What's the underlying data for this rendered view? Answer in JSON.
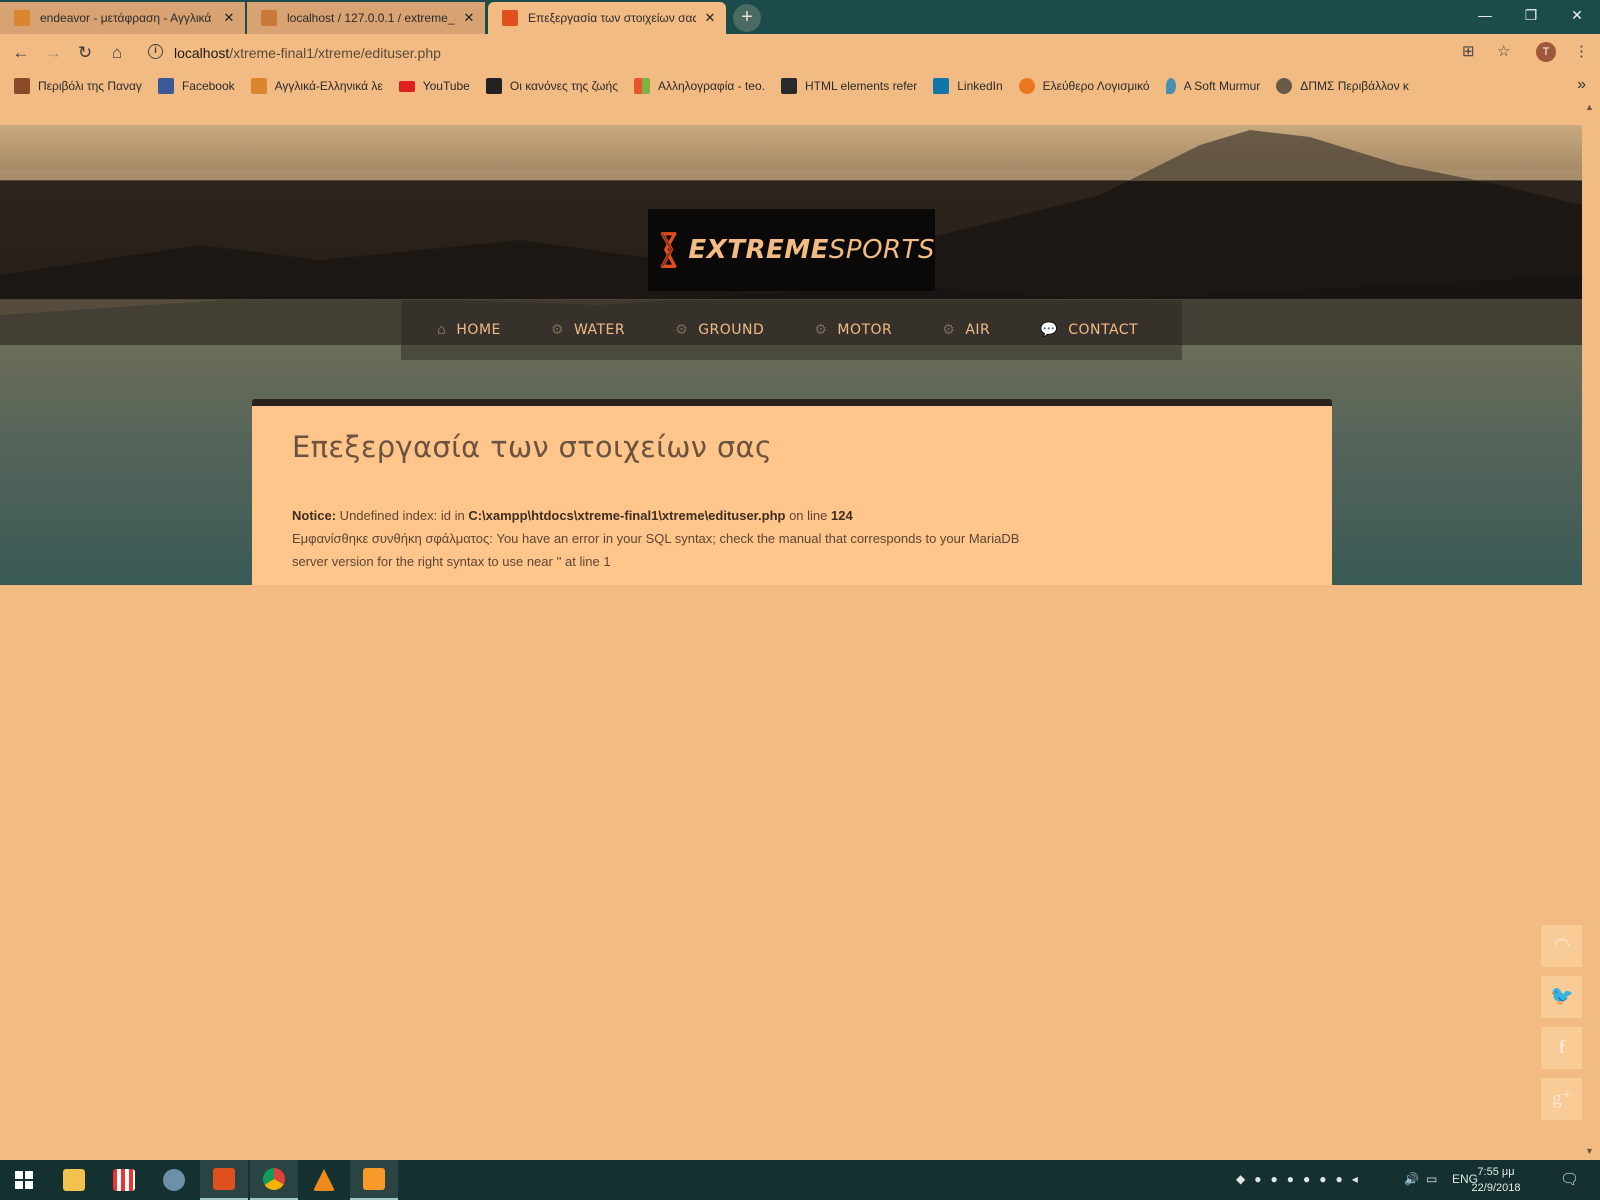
{
  "browser": {
    "tabs": [
      {
        "title": "endeavor - μετάφραση - Αγγλικά",
        "active": false
      },
      {
        "title": "localhost / 127.0.0.1 / extreme_e",
        "active": false
      },
      {
        "title": "Επεξεργασία των στοιχείων σας",
        "active": true
      }
    ],
    "new_tab_label": "+",
    "window_controls": {
      "minimize": "—",
      "maximize": "❐",
      "close": "✕"
    },
    "url": {
      "host": "localhost",
      "path": "/xtreme-final1/xtreme/edituser.php"
    },
    "profile_initial": "T"
  },
  "bookmarks": [
    {
      "label": "Περιβόλι της Παναγ",
      "color": "#8a4a2a"
    },
    {
      "label": "Facebook",
      "color": "#3b5998"
    },
    {
      "label": "Αγγλικά-Ελληνικά λε",
      "color": "#d9862e"
    },
    {
      "label": "YouTube",
      "color": "#e02020"
    },
    {
      "label": "Οι κανόνες της ζωής",
      "color": "#222222"
    },
    {
      "label": "Αλληλογραφία - teo.",
      "color": "#e8552a"
    },
    {
      "label": "HTML elements refer",
      "color": "#2a2a2a"
    },
    {
      "label": "LinkedIn",
      "color": "#0e76a8"
    },
    {
      "label": "Ελεύθερο Λογισμικό",
      "color": "#e8771e"
    },
    {
      "label": "A Soft Murmur",
      "color": "#4a8fb0"
    },
    {
      "label": "ΔΠΜΣ Περιβάλλον κ",
      "color": "#6a5a4a"
    }
  ],
  "site": {
    "logo": {
      "bold": "EXTREME",
      "light": "SPORTS"
    },
    "nav": [
      {
        "label": "HOME",
        "icon": "home-icon"
      },
      {
        "label": "WATER",
        "icon": "gears-icon"
      },
      {
        "label": "GROUND",
        "icon": "gears-icon"
      },
      {
        "label": "MOTOR",
        "icon": "gears-icon"
      },
      {
        "label": "AIR",
        "icon": "gears-icon"
      },
      {
        "label": "CONTACT",
        "icon": "speech-bubble-icon"
      }
    ],
    "heading": "Επεξεργασία των στοιχείων σας",
    "notice": {
      "label": "Notice:",
      "text1": " Undefined index: id in ",
      "path": "C:\\xampp\\htdocs\\xtreme-final1\\xtreme\\edituser.php",
      "text2": " on line ",
      "line": "124"
    },
    "error_message": "Εμφανίσθηκε συνθήκη σφάλματος: You have an error in your SQL syntax; check the manual that corresponds to your MariaDB server version for the right syntax to use near '' at line 1",
    "social": [
      "rss-icon",
      "twitter-icon",
      "facebook-icon",
      "google-plus-icon"
    ]
  },
  "taskbar": {
    "language": "ENG",
    "time": "7:55 μμ",
    "date": "22/9/2018"
  },
  "colors": {
    "page_bg": "#f2bb84",
    "tabstrip_bg": "#1b4b4a",
    "content_bg": "#ffc58b",
    "nav_text": "#f2bb84",
    "logo_accent": "#e0501e"
  }
}
